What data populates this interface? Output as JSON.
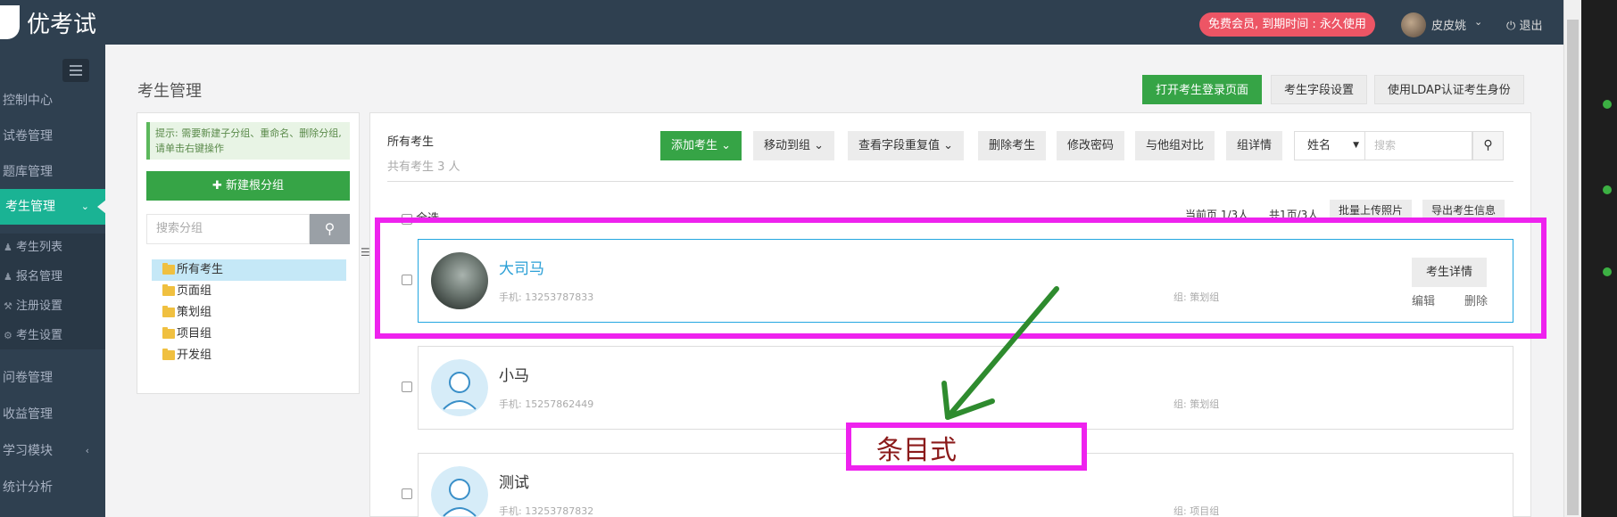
{
  "app": {
    "logo_text": "优考试"
  },
  "header": {
    "member_badge": "免费会员, 到期时间 : 永久使用",
    "user_name": "皮皮姚",
    "logout": "退出"
  },
  "sidebar": {
    "items": [
      {
        "label": "控制中心"
      },
      {
        "label": "试卷管理"
      },
      {
        "label": "题库管理"
      },
      {
        "label": "考生管理"
      },
      {
        "label": "问卷管理"
      },
      {
        "label": "收益管理"
      },
      {
        "label": "学习模块"
      },
      {
        "label": "统计分析"
      }
    ],
    "sub_items": [
      {
        "label": "考生列表",
        "icon": "user-icon"
      },
      {
        "label": "报名管理",
        "icon": "users-icon"
      },
      {
        "label": "注册设置",
        "icon": "wrench-icon"
      },
      {
        "label": "考生设置",
        "icon": "gear-icon"
      }
    ]
  },
  "page": {
    "title": "考生管理",
    "top_buttons": [
      "打开考生登录页面",
      "考生字段设置",
      "使用LDAP认证考生身份"
    ]
  },
  "left_panel": {
    "hint": "提示: 需要新建子分组、重命名、删除分组, 请单击右键操作",
    "new_group": "新建根分组",
    "search_placeholder": "搜索分组",
    "tree": [
      "所有考生",
      "页面组",
      "策划组",
      "项目组",
      "开发组"
    ]
  },
  "right_panel": {
    "heading": "所有考生",
    "count": "共有考生 3 人",
    "toolbar": [
      "添加考生",
      "移动到组",
      "查看字段重复值",
      "删除考生",
      "修改密码",
      "与他组对比",
      "组详情"
    ],
    "search_field": "姓名",
    "search_placeholder": "搜索",
    "select_all": "全选",
    "page_info": "当前页 1/3人",
    "page_total": "共1页/3人",
    "batch_upload": "批量上传照片",
    "export": "导出考生信息"
  },
  "students": [
    {
      "name": "大司马",
      "phone": "手机: 13253787833",
      "group": "组: 策划组"
    },
    {
      "name": "小马",
      "phone": "手机: 15257862449",
      "group": "组: 策划组"
    },
    {
      "name": "测试",
      "phone": "手机: 13253787832",
      "group": "组: 项目组"
    }
  ],
  "card_actions": {
    "detail": "考生详情",
    "edit": "编辑",
    "delete": "删除"
  },
  "annotation": {
    "label": "条目式"
  },
  "colors": {
    "accent": "#1ab394",
    "primary_green": "#36a446",
    "annotation": "#ee22ee",
    "arrow": "#2e8b2e"
  }
}
